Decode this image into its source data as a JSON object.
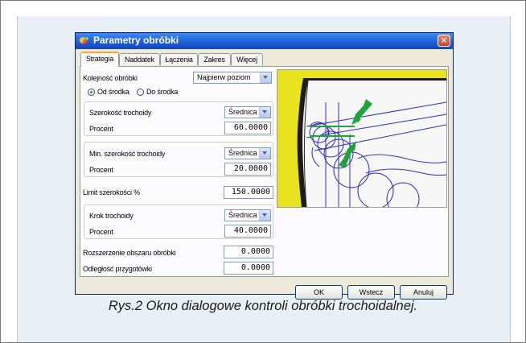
{
  "dialog": {
    "title": "Parametry obróbki",
    "tabs": [
      "Strategia",
      "Naddatek",
      "Łączenia",
      "Zakres",
      "Więcej"
    ],
    "active_tab": "Strategia",
    "order_label": "Kolejność obróbki",
    "order_value": "Najpierw poziom",
    "radio_from_center": "Od środka",
    "radio_to_center": "Do środka",
    "radio_selected": "Od środka",
    "group1": {
      "width_label": "Szerokość trochoidy",
      "mode_value": "Średnica",
      "percent_label": "Procent",
      "percent_value": "60.0000"
    },
    "group2": {
      "width_label": "Min. szerokość trochoidy",
      "mode_value": "Średnica",
      "percent_label": "Procent",
      "percent_value": "20.0000"
    },
    "limit_label": "Limit szerokości %",
    "limit_value": "150.0000",
    "group3": {
      "step_label": "Krok trochoidy",
      "mode_value": "Średnica",
      "percent_label": "Procent",
      "percent_value": "40.0000"
    },
    "extension_label": "Rozszerzenie obszaru obróbki",
    "extension_value": "0.0000",
    "distance_label": "Odległość przygotówki",
    "distance_value": "0.0000",
    "buttons": {
      "ok": "OK",
      "back": "Wstecz",
      "cancel": "Anuluj"
    }
  },
  "caption": "Rys.2 Okno dialogowe kontroli obróbki trochoidalnej.",
  "colors": {
    "titlebar": "#1d5ad7",
    "preview_yellow": "#e8e31c",
    "arrow_green": "#1fa33a",
    "figure_background": "#e8f0f6"
  },
  "icons": [
    "app-icon",
    "close-icon",
    "chevron-down-icon",
    "radio-icon"
  ]
}
